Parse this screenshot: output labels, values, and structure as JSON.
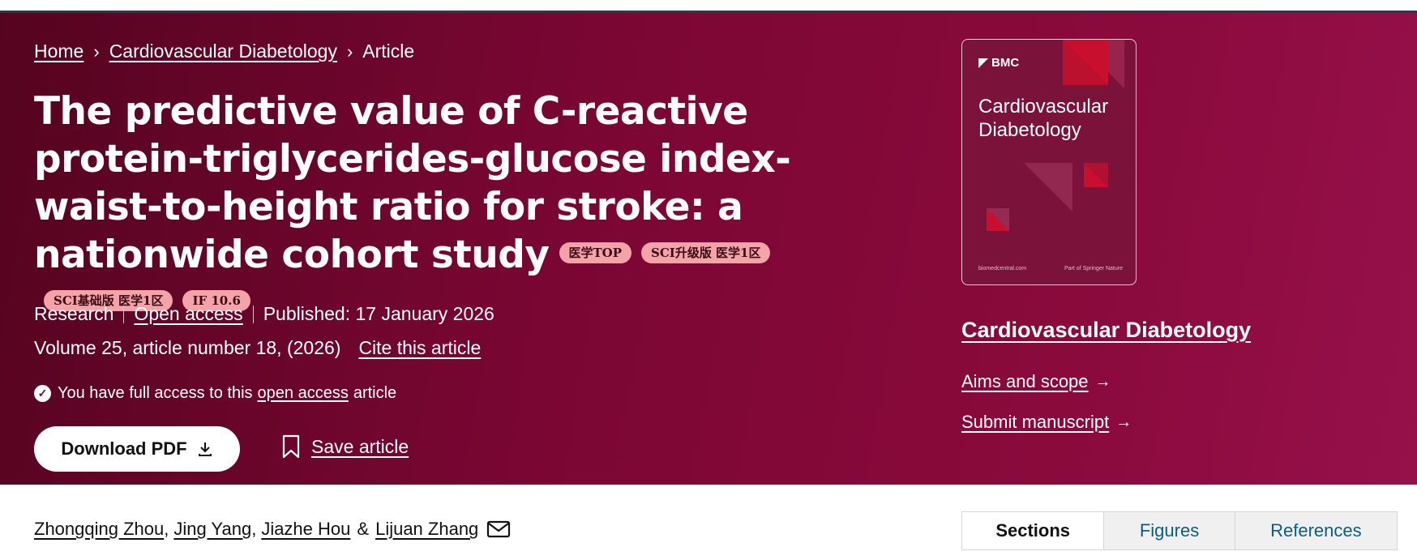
{
  "breadcrumb": {
    "home": "Home",
    "journal": "Cardiovascular Diabetology",
    "current": "Article",
    "separator": "›"
  },
  "article": {
    "title": "The predictive value of C-reactive protein-triglycerides-glucose index-waist-to-height ratio for stroke: a nationwide cohort study",
    "badges": [
      "医学TOP",
      "SCI升级版 医学1区",
      "SCI基础版 医学1区",
      "IF 10.6"
    ],
    "type": "Research",
    "open_access": "Open access",
    "published": "Published: 17 January 2026",
    "volume": "Volume 25, article number 18, (2026)",
    "cite": "Cite this article",
    "access_prefix": "You have full access to this",
    "access_link": "open access",
    "access_suffix": "article",
    "download_label": "Download PDF",
    "save_label": "Save article"
  },
  "journal": {
    "cover_brand": "BMC",
    "cover_name": "Cardiovascular Diabetology",
    "cover_footer_left": "biomedcentral.com",
    "cover_footer_right": "Part of Springer Nature",
    "link": "Cardiovascular Diabetology",
    "aims": "Aims and scope",
    "submit": "Submit manuscript"
  },
  "authors": [
    "Zhongqing Zhou",
    "Jing Yang",
    "Jiazhe Hou",
    "Lijuan Zhang"
  ],
  "authors_sep": ",",
  "authors_amp": "&",
  "tabs": [
    "Sections",
    "Figures",
    "References"
  ],
  "colors": {
    "hero_start": "#55041f",
    "hero_end": "#96104a",
    "badge_bg": "#f4a3a9",
    "tab_link": "#0b5d86"
  },
  "icons": {
    "download": "download-icon",
    "bookmark": "bookmark-icon",
    "check": "check-circle-icon",
    "mail": "mail-icon",
    "arrow": "arrow-right-icon"
  }
}
